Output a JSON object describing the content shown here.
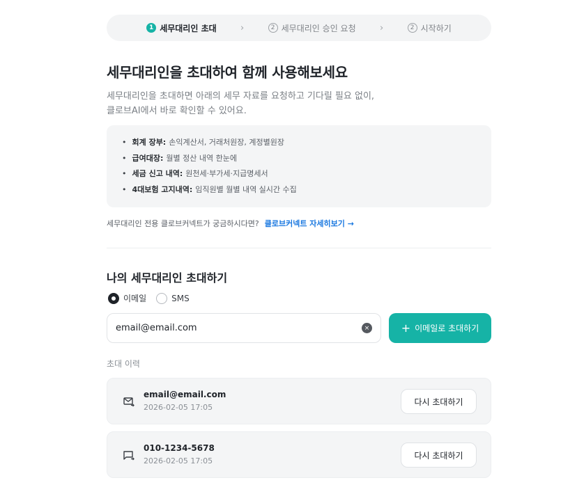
{
  "stepper": {
    "steps": [
      {
        "num": "1",
        "label": "세무대리인 초대",
        "active": true
      },
      {
        "num": "2",
        "label": "세무대리인 승인 요청",
        "active": false
      },
      {
        "num": "2",
        "label": "시작하기",
        "active": false
      }
    ],
    "separator": "›"
  },
  "page": {
    "title": "세무대리인을 초대하여 함께 사용해보세요",
    "desc_line1": "세무대리인을 초대하면 아래의 세무 자료를 요청하고 기다릴 필요 없이,",
    "desc_line2": "클로브AI에서 바로 확인할 수 있어요."
  },
  "info": {
    "items": [
      {
        "label": "회계 장부:",
        "value": "손익계산서, 거래처원장, 계정별원장"
      },
      {
        "label": "급여대장:",
        "value": "월별 정산 내역 한눈에"
      },
      {
        "label": "세금 신고 내역:",
        "value": "원천세·부가세·지급명세서"
      },
      {
        "label": "4대보험 고지내역:",
        "value": "임직원별 월별 내역 실시간 수집"
      }
    ]
  },
  "connect": {
    "question": "세무대리인 전용 클로브커넥트가 궁금하시다면?",
    "link": "클로브커넥트 자세히보기 →"
  },
  "invite": {
    "title": "나의 세무대리인 초대하기",
    "radio_email": "이메일",
    "radio_sms": "SMS",
    "selected": "email",
    "input_value": "email@email.com",
    "clear_icon": "×",
    "button_plus": "+",
    "button_label": "이메일로 초대하기"
  },
  "history": {
    "label": "초대 이력",
    "items": [
      {
        "type": "email",
        "contact": "email@email.com",
        "time": "2026-02-05 17:05",
        "button": "다시 초대하기"
      },
      {
        "type": "sms",
        "contact": "010-1234-5678",
        "time": "2026-02-05 17:05",
        "button": "다시 초대하기"
      }
    ]
  },
  "colors": {
    "accent": "#16b3a6",
    "link": "#1a78e0"
  }
}
